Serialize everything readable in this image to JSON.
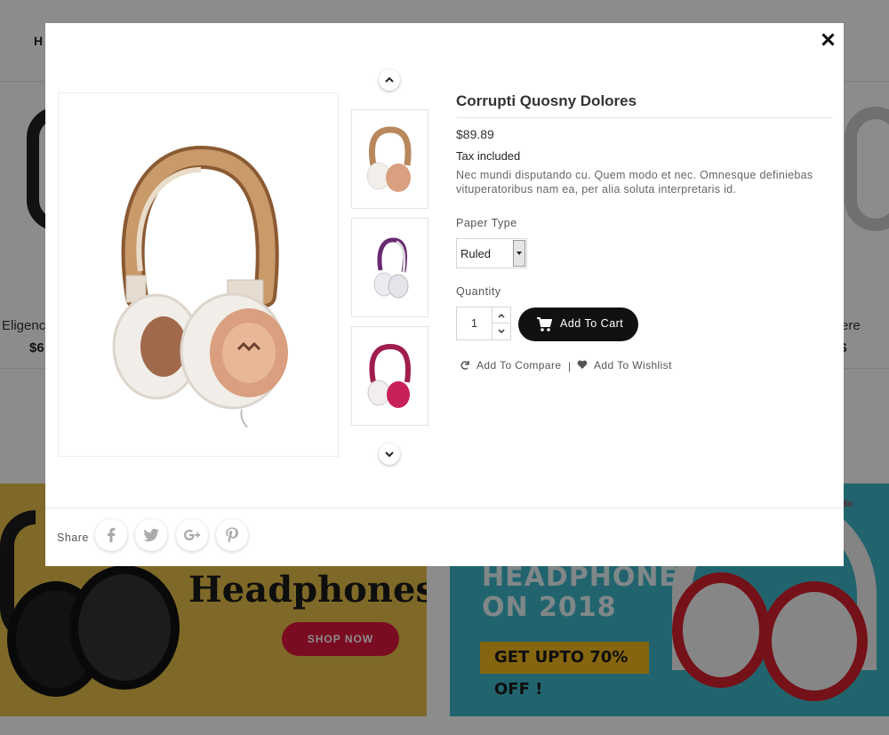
{
  "background": {
    "nav_text": "H",
    "products": [
      {
        "name": "Eligenc",
        "price": "$6"
      },
      {
        "name": "ere",
        "price": "$"
      }
    ],
    "banner_left": {
      "title": "Headphones",
      "button": "SHOP NOW"
    },
    "banner_right": {
      "line1": "HEADPHONE",
      "line2": "ON 2018",
      "offer": "GET UPTO 70% OFF !",
      "brand": "dio"
    }
  },
  "modal": {
    "product_title": "Corrupti Quosny Dolores",
    "price": "$89.89",
    "tax_label": "Tax included",
    "description": "Nec mundi disputando cu. Quem modo et nec. Omnesque definiebas vituperatoribus nam ea, per alia soluta interpretaris id.",
    "paper_type_label": "Paper Type",
    "paper_type_value": "Ruled",
    "quantity_label": "Quantity",
    "quantity_value": "1",
    "add_to_cart": "Add To Cart",
    "add_to_compare": "Add To Compare",
    "separator": "|",
    "add_to_wishlist": "Add To Wishlist",
    "share_label": "Share",
    "social": [
      "facebook-icon",
      "twitter-icon",
      "google-plus-icon",
      "pinterest-icon"
    ],
    "thumbnails": [
      "rose-gold headphones",
      "purple headphones",
      "pink headphones"
    ]
  },
  "colors": {
    "accent_dark": "#111111",
    "overlay": "rgba(0,0,0,0.45)",
    "banner_yellow": "#e8c04a",
    "banner_cyan": "#3fb7c8",
    "shop_now_red": "#e0143c",
    "offer_yellow": "#f2b81c"
  }
}
